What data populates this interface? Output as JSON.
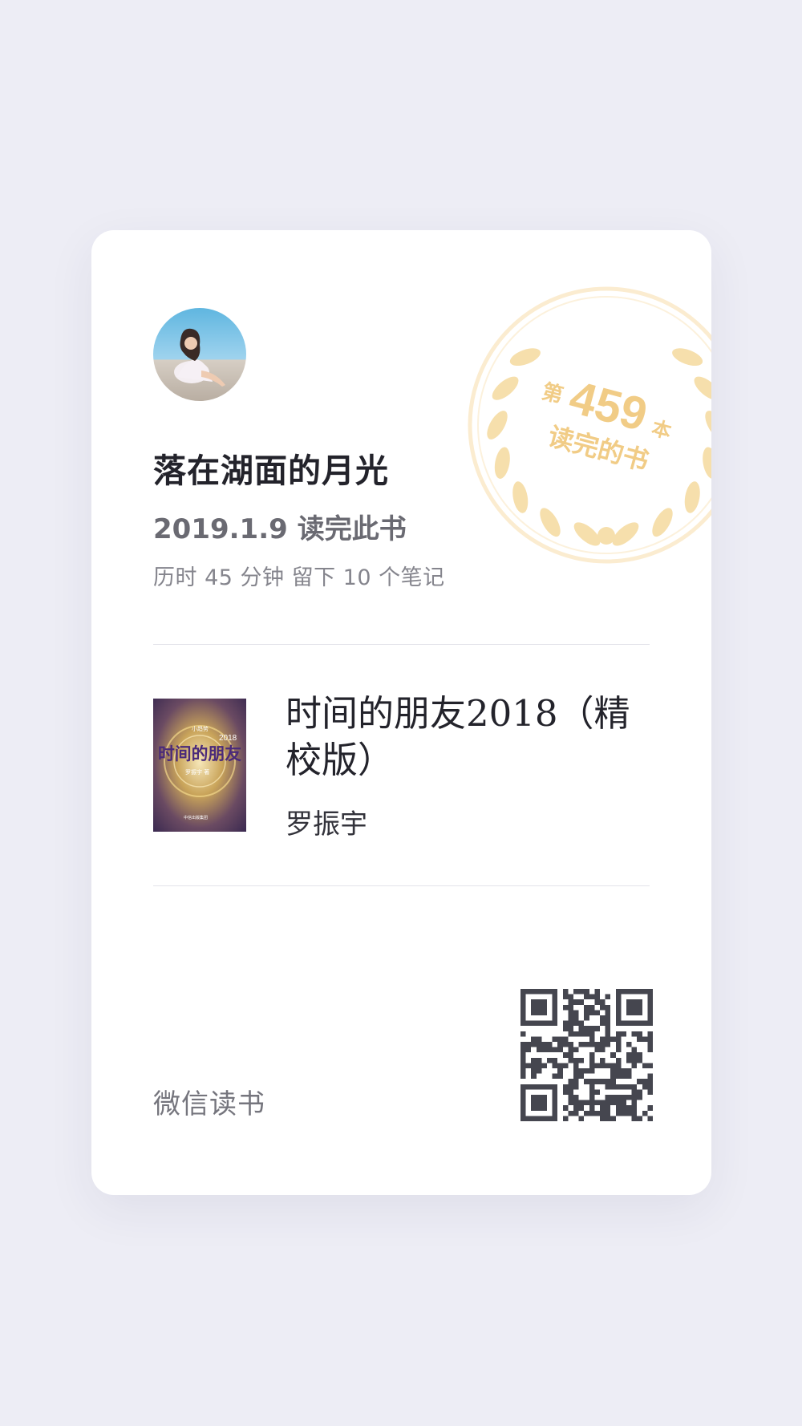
{
  "user": {
    "name": "落在湖面的月光",
    "avatar_icon": "user-avatar-photo"
  },
  "reading": {
    "date": "2019.1.9",
    "status_text": "读完此书",
    "stats": "历时 45 分钟 留下 10 个笔记"
  },
  "seal": {
    "prefix": "第",
    "count": "459",
    "suffix": "本",
    "caption": "读完的书",
    "color": "#f5d99c"
  },
  "book": {
    "title": "时间的朋友2018（精校版）",
    "author": "罗振宇",
    "cover_title": "时间的朋友",
    "cover_year": "2018",
    "cover_top": "小趋势",
    "cover_author": "罗振宇 著",
    "cover_publisher": "中信出版集团"
  },
  "footer": {
    "brand": "微信读书",
    "qr_icon": "qr-code-icon"
  },
  "colors": {
    "page_bg": "#ededf5",
    "card_bg": "#ffffff",
    "text_primary": "#23232b",
    "text_secondary": "#6a6a72",
    "qr_color": "#45464f"
  }
}
